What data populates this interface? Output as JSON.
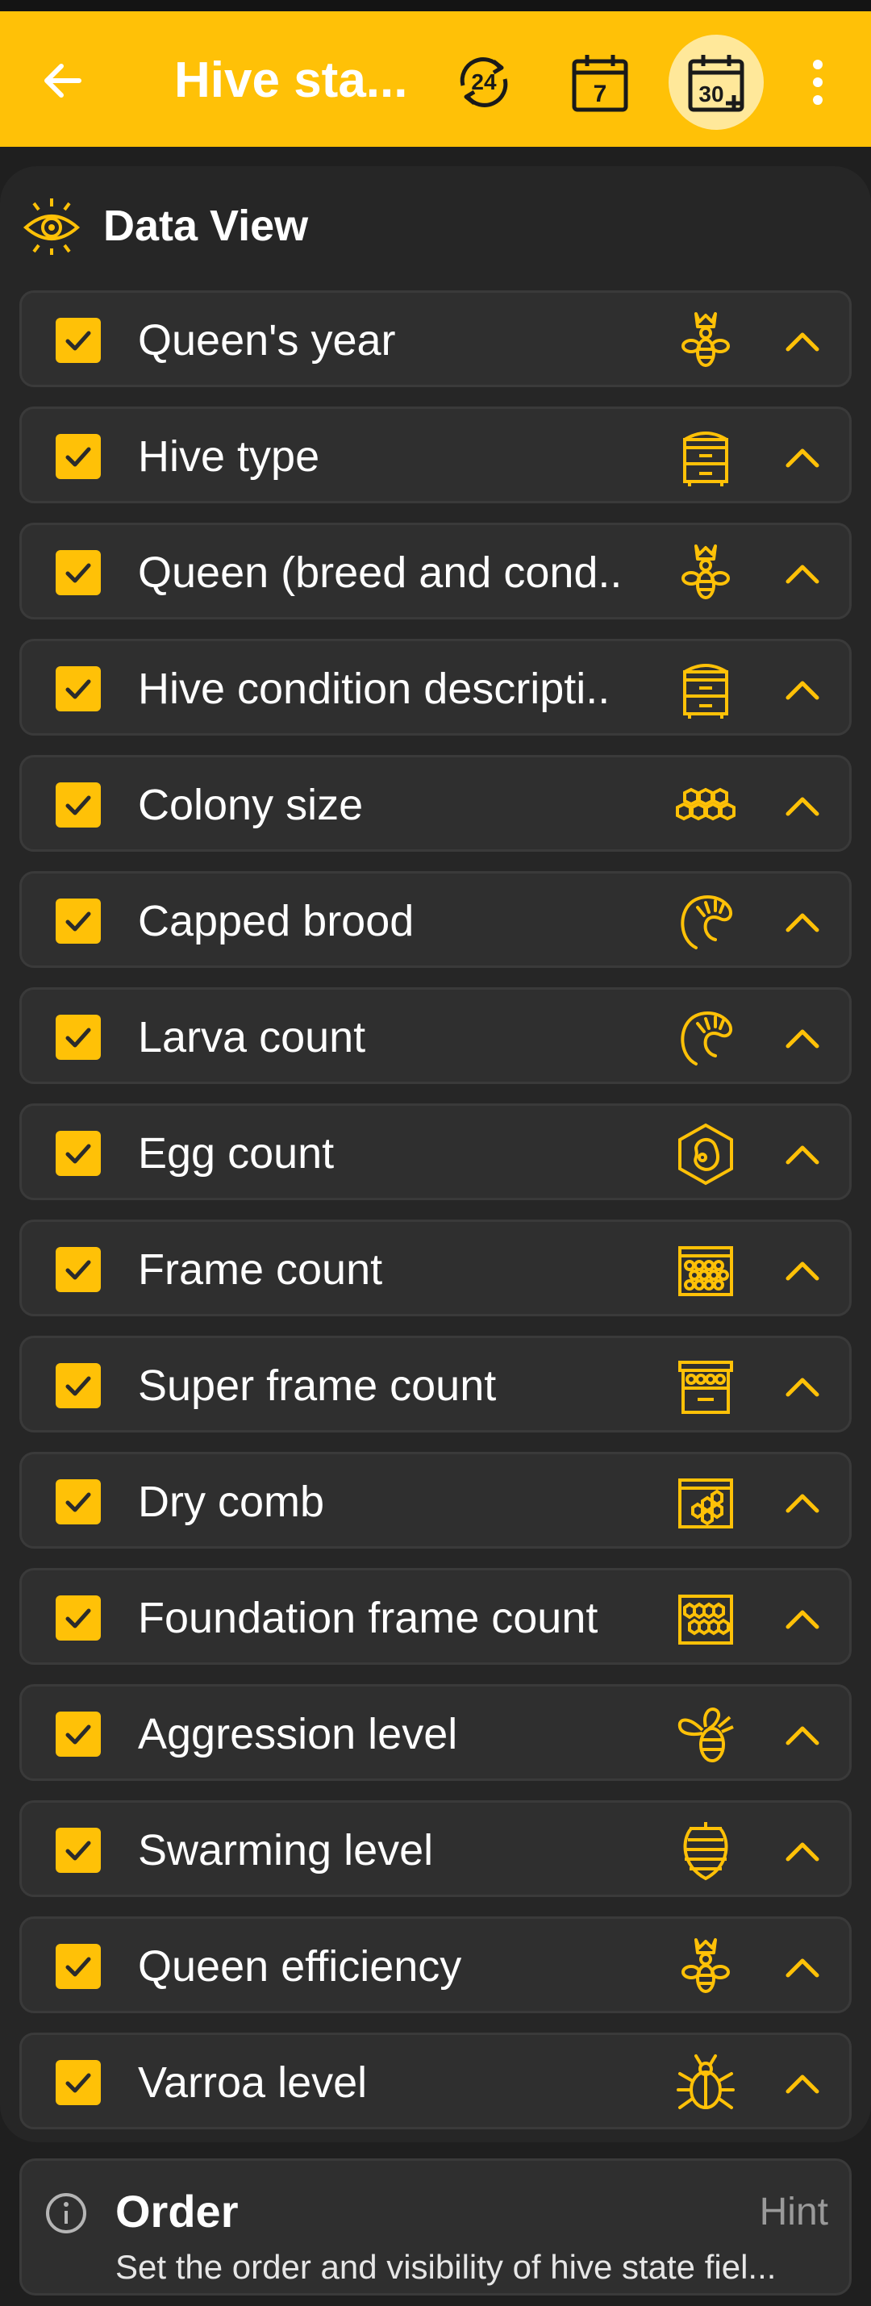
{
  "appbar": {
    "title": "Hive sta...",
    "actions": [
      {
        "icon": "24-hours-icon"
      },
      {
        "icon": "calendar-7-icon",
        "text": "7"
      },
      {
        "icon": "calendar-30-plus-icon",
        "text": "30",
        "selected": true
      },
      {
        "icon": "more-vert-icon"
      }
    ]
  },
  "panel": {
    "title": "Data View"
  },
  "rows": [
    {
      "label": "Queen's year",
      "icon": "queen-bee-icon",
      "checked": true
    },
    {
      "label": "Hive type",
      "icon": "hive-box-icon",
      "checked": true
    },
    {
      "label": "Queen (breed and cond..",
      "icon": "queen-bee-icon",
      "checked": true
    },
    {
      "label": "Hive condition descripti..",
      "icon": "hive-box-icon",
      "checked": true
    },
    {
      "label": "Colony size",
      "icon": "honeycomb-icon",
      "checked": true
    },
    {
      "label": "Capped brood",
      "icon": "larva-icon",
      "checked": true
    },
    {
      "label": "Larva count",
      "icon": "larva-icon",
      "checked": true
    },
    {
      "label": "Egg count",
      "icon": "egg-icon",
      "checked": true
    },
    {
      "label": "Frame count",
      "icon": "frame-icon",
      "checked": true
    },
    {
      "label": "Super frame count",
      "icon": "super-frame-icon",
      "checked": true
    },
    {
      "label": "Dry comb",
      "icon": "dry-comb-icon",
      "checked": true
    },
    {
      "label": "Foundation frame count",
      "icon": "foundation-frame-icon",
      "checked": true
    },
    {
      "label": "Aggression level",
      "icon": "angry-bee-icon",
      "checked": true
    },
    {
      "label": "Swarming level",
      "icon": "swarm-icon",
      "checked": true
    },
    {
      "label": "Queen efficiency",
      "icon": "queen-bee-icon",
      "checked": true
    },
    {
      "label": "Varroa level",
      "icon": "varroa-mite-icon",
      "checked": true
    }
  ],
  "hint": {
    "title": "Order",
    "tag": "Hint",
    "body": "Set the order and visibility of hive state fiel..."
  },
  "colors": {
    "accent": "#ffc107",
    "background": "#1f1f1f",
    "row": "#2f2f2f"
  }
}
